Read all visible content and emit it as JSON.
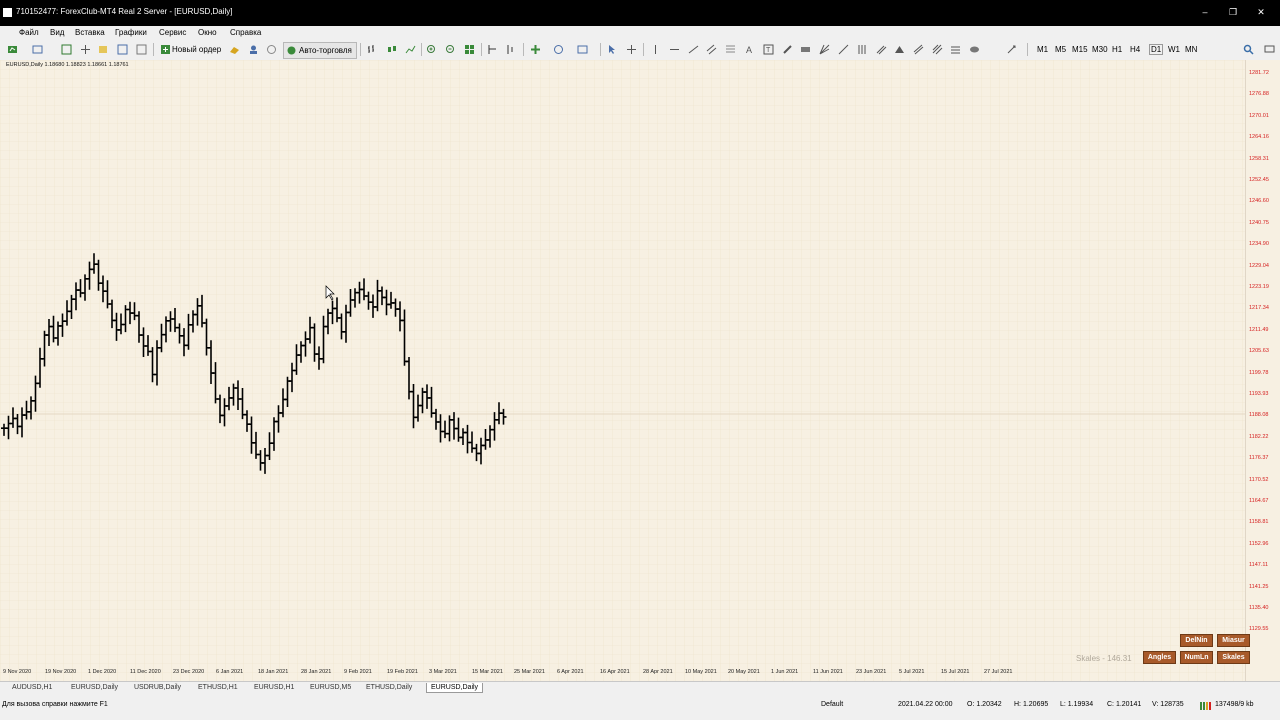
{
  "window": {
    "title": "710152477: ForexClub-MT4 Real 2 Server - [EURUSD,Daily]",
    "controls": [
      "–",
      "❐",
      "✕"
    ]
  },
  "menu": [
    "Файл",
    "Вид",
    "Вставка",
    "Графики",
    "Сервис",
    "Окно",
    "Справка"
  ],
  "toolbar": {
    "new_order": "Новый ордер",
    "auto_trading": "Авто-торговля",
    "timeframes": [
      "M1",
      "M5",
      "M15",
      "M30",
      "H1",
      "H4",
      "D1",
      "W1",
      "MN"
    ]
  },
  "chart": {
    "symbol_info": "EURUSD,Daily  1.18680 1.18823 1.18661 1.18761",
    "price_labels": [
      "1281.72",
      "1276.88",
      "1270.01",
      "1264.16",
      "1258.31",
      "1252.45",
      "1246.60",
      "1240.75",
      "1234.90",
      "1229.04",
      "1223.19",
      "1217.34",
      "1211.49",
      "1205.63",
      "1199.78",
      "1193.93",
      "1188.08",
      "1182.22",
      "1176.37",
      "1170.52",
      "1164.67",
      "1158.81",
      "1152.96",
      "1147.11",
      "1141.25",
      "1135.40",
      "1129.55"
    ],
    "date_labels": [
      "9 Nov 2020",
      "19 Nov 2020",
      "1 Dec 2020",
      "11 Dec 2020",
      "23 Dec 2020",
      "6 Jan 2021",
      "18 Jan 2021",
      "28 Jan 2021",
      "9 Feb 2021",
      "19 Feb 2021",
      "3 Mar 2021",
      "15 Mar 2021",
      "25 Mar 2021",
      "6 Apr 2021",
      "16 Apr 2021",
      "28 Apr 2021",
      "10 May 2021",
      "20 May 2021",
      "1 Jun 2021",
      "11 Jun 2021",
      "23 Jun 2021",
      "5 Jul 2021",
      "15 Jul 2021",
      "27 Jul 2021"
    ],
    "skales_text": "Skales - 146.31",
    "buttons": [
      "DelNin",
      "Miasur",
      "Angles",
      "NumLn",
      "Skales"
    ]
  },
  "chart_data": {
    "type": "ohlc",
    "symbol": "EURUSD",
    "timeframe": "Daily",
    "x_start": "9 Nov 2020",
    "x_end": "27 Jul 2021",
    "ylim": [
      1129.55,
      1281.72
    ],
    "close_path": [
      1184.5,
      1185.8,
      1187.2,
      1185.0,
      1188.1,
      1189.0,
      1192.0,
      1196.8,
      1203.5,
      1210.0,
      1212.3,
      1209.2,
      1212.5,
      1213.8,
      1216.5,
      1219.8,
      1222.3,
      1221.5,
      1225.4,
      1228.0,
      1229.4,
      1224.2,
      1222.0,
      1218.5,
      1214.0,
      1211.4,
      1212.9,
      1217.0,
      1216.0,
      1215.3,
      1210.0,
      1207.0,
      1205.5,
      1199.2,
      1206.5,
      1210.1,
      1213.9,
      1214.4,
      1212.0,
      1209.8,
      1207.2,
      1212.8,
      1215.6,
      1218.0,
      1213.3,
      1206.5,
      1199.6,
      1192.5,
      1188.0,
      1190.6,
      1192.8,
      1195.5,
      1192.5,
      1188.2,
      1185.6,
      1180.5,
      1177.3,
      1175.0,
      1177.0,
      1180.4,
      1186.3,
      1188.7,
      1192.4,
      1197.4,
      1200.3,
      1204.5,
      1207.1,
      1208.9,
      1212.0,
      1204.8,
      1203.5,
      1212.3,
      1216.0,
      1217.3,
      1214.7,
      1210.9,
      1216.2,
      1219.6,
      1221.6,
      1222.5,
      1220.7,
      1219.0,
      1217.7,
      1222.1,
      1220.3,
      1218.4,
      1218.8,
      1217.1,
      1214.0,
      1202.8,
      1194.5,
      1187.5,
      1190.7,
      1194.4,
      1192.8,
      1188.6,
      1186.2,
      1183.6,
      1183.0,
      1186.8,
      1184.4,
      1182.0,
      1183.3,
      1180.6,
      1179.0,
      1177.6,
      1179.8,
      1181.3,
      1184.1,
      1186.8,
      1188.6,
      1187.6
    ]
  },
  "tabs": [
    "AUDUSD,H1",
    "EURUSD,Daily",
    "USDRUB,Daily",
    "ETHUSD,H1",
    "EURUSD,H1",
    "EURUSD,M5",
    "ETHUSD,Daily",
    "EURUSD,Daily"
  ],
  "status": {
    "help": "Для вызова справки нажмите F1",
    "profile": "Default",
    "datetime": "2021.04.22 00:00",
    "open": "O: 1.20342",
    "high": "H: 1.20695",
    "low": "L: 1.19934",
    "close": "C: 1.20141",
    "volume": "V: 128735",
    "traffic": "137498/9 kb"
  },
  "colors": {
    "price_axis": "#d52020",
    "chart_bg": "#f7f0e2",
    "button": "#a85a2a"
  }
}
